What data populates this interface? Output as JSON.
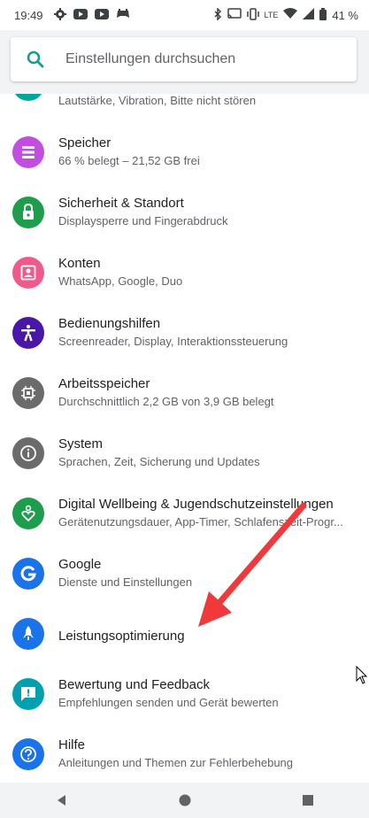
{
  "status_bar": {
    "time": "19:49",
    "left_icons": [
      "settings-gear-icon",
      "youtube-icon",
      "youtube-icon",
      "game-controller-icon"
    ],
    "right_icons": [
      "bluetooth-icon",
      "cast-icon",
      "vibrate-icon",
      "lte-icon",
      "wifi-icon",
      "signal-icon",
      "battery-icon"
    ],
    "lte_label": "LTE",
    "battery": "41 %"
  },
  "search": {
    "placeholder": "Einstellungen durchsuchen"
  },
  "settings": [
    {
      "title": "",
      "subtitle": "Lautstärke, Vibration, Bitte nicht stören",
      "icon": "volume-icon",
      "color": "#00a59a"
    },
    {
      "title": "Speicher",
      "subtitle": "66 % belegt – 21,52 GB frei",
      "icon": "storage-icon",
      "color": "#c24ee0"
    },
    {
      "title": "Sicherheit & Standort",
      "subtitle": "Displaysperre und Fingerabdruck",
      "icon": "lock-icon",
      "color": "#1e9d4c"
    },
    {
      "title": "Konten",
      "subtitle": "WhatsApp, Google, Duo",
      "icon": "account-icon",
      "color": "#ef5a8c"
    },
    {
      "title": "Bedienungshilfen",
      "subtitle": "Screenreader, Display, Interaktionssteuerung",
      "icon": "accessibility-icon",
      "color": "#4a16a8"
    },
    {
      "title": "Arbeitsspeicher",
      "subtitle": "Durchschnittlich 2,2 GB von 3,9 GB belegt",
      "icon": "memory-chip-icon",
      "color": "#6b6b6b"
    },
    {
      "title": "System",
      "subtitle": "Sprachen, Zeit, Sicherung und Updates",
      "icon": "info-icon",
      "color": "#6b6b6b"
    },
    {
      "title": "Digital Wellbeing & Jugendschutzeinstellungen",
      "subtitle": "Gerätenutzungsdauer, App-Timer, Schlafenszeit-Progr...",
      "icon": "wellbeing-heart-icon",
      "color": "#1e9d4c"
    },
    {
      "title": "Google",
      "subtitle": "Dienste und Einstellungen",
      "icon": "google-g-icon",
      "color": "#1a73e8"
    },
    {
      "title": "Leistungsoptimierung",
      "subtitle": "",
      "icon": "rocket-icon",
      "color": "#1a73e8"
    },
    {
      "title": "Bewertung und Feedback",
      "subtitle": "Empfehlungen senden und Gerät bewerten",
      "icon": "feedback-icon",
      "color": "#00a0b0"
    },
    {
      "title": "Hilfe",
      "subtitle": "Anleitungen und Themen zur Fehlerbehebung",
      "icon": "help-icon",
      "color": "#1a73e8"
    }
  ],
  "annotation": {
    "color": "#f0393a"
  },
  "navbar": {
    "buttons": [
      "back-icon",
      "home-icon",
      "recents-icon"
    ]
  }
}
